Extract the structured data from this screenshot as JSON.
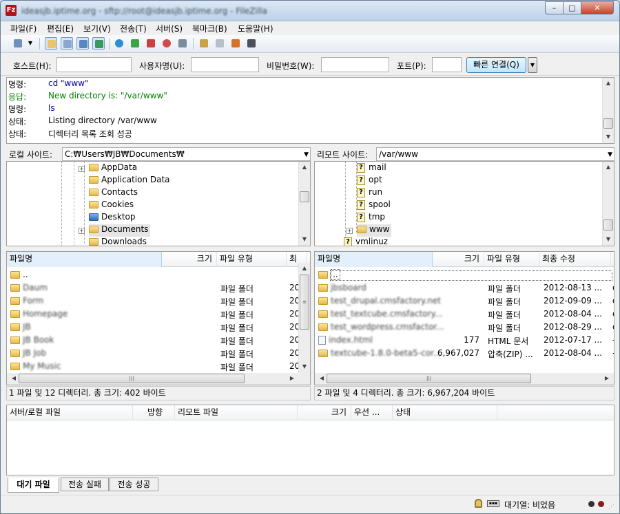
{
  "window": {
    "title": "ideasjb.iptime.org - sftp://root@ideasjb.iptime.org - FileZilla"
  },
  "menu": [
    "파일(F)",
    "편집(E)",
    "보기(V)",
    "전송(T)",
    "서버(S)",
    "북마크(B)",
    "도움말(H)"
  ],
  "quickconnect": {
    "host_label": "호스트(H):",
    "user_label": "사용자명(U):",
    "pass_label": "비밀번호(W):",
    "port_label": "포트(P):",
    "button": "빠른 연결(Q)"
  },
  "log": [
    {
      "kind": "명령:",
      "msg": "cd \"www\"",
      "color": "#0000b0"
    },
    {
      "kind": "응답:",
      "msg": "New directory is: \"/var/www\"",
      "color": "#008000"
    },
    {
      "kind": "명령:",
      "msg": "ls",
      "color": "#0000b0"
    },
    {
      "kind": "상태:",
      "msg": "Listing directory /var/www",
      "color": "#000000"
    },
    {
      "kind": "상태:",
      "msg": "디렉터리 목록 조회 성공",
      "color": "#000000"
    }
  ],
  "local": {
    "label": "로컬 사이트:",
    "path": "C:₩Users₩JB₩Documents₩",
    "tree": [
      "AppData",
      "Application Data",
      "Contacts",
      "Cookies",
      "Desktop",
      "Documents",
      "Downloads"
    ],
    "columns": [
      "파일명",
      "크기",
      "파일 유형",
      "최"
    ],
    "files": [
      {
        "name": "..",
        "type": "",
        "date": ""
      },
      {
        "name": "Daum",
        "type": "파일 폴더",
        "date": "20"
      },
      {
        "name": "Form",
        "type": "파일 폴더",
        "date": "20"
      },
      {
        "name": "Homepage",
        "type": "파일 폴더",
        "date": "20"
      },
      {
        "name": "JB",
        "type": "파일 폴더",
        "date": "20"
      },
      {
        "name": "JB Book",
        "type": "파일 폴더",
        "date": "20"
      },
      {
        "name": "JB Job",
        "type": "파일 폴더",
        "date": "20"
      },
      {
        "name": "My Music",
        "type": "파일 폴더",
        "date": "20"
      }
    ],
    "status": "1 파일 및 12 디렉터리. 총 크기: 402 바이트"
  },
  "remote": {
    "label": "리모트 사이트:",
    "path": "/var/www",
    "tree": [
      "mail",
      "opt",
      "run",
      "spool",
      "tmp",
      "www",
      "vmlinuz"
    ],
    "columns": [
      "파일명",
      "크기",
      "파일 유형",
      "최종 수정",
      "ㄱ"
    ],
    "files": [
      {
        "name": "..",
        "size": "",
        "type": "",
        "date": "",
        "extra": ""
      },
      {
        "name": "jbsboard",
        "size": "",
        "type": "파일 폴더",
        "date": "2012-08-13 ...",
        "extra": "d"
      },
      {
        "name": "test_drupal.cmsfactory.net",
        "size": "",
        "type": "파일 폴더",
        "date": "2012-09-09 ...",
        "extra": "d"
      },
      {
        "name": "test_textcube.cmsfactory...",
        "size": "",
        "type": "파일 폴더",
        "date": "2012-08-04 ...",
        "extra": "d"
      },
      {
        "name": "test_wordpress.cmsfactor...",
        "size": "",
        "type": "파일 폴더",
        "date": "2012-08-29 ...",
        "extra": "d"
      },
      {
        "name": "index.html",
        "size": "177",
        "type": "HTML 문서",
        "date": "2012-07-17 ...",
        "extra": "-"
      },
      {
        "name": "textcube-1.8.0-beta5-cor...",
        "size": "6,967,027",
        "type": "압축(ZIP) ...",
        "date": "2012-08-04 ...",
        "extra": "-"
      }
    ],
    "status": "2 파일 및 4 디렉터리. 총 크기: 6,967,204 바이트"
  },
  "queue": {
    "columns": [
      "서버/로컬 파일",
      "방향",
      "리모트 파일",
      "크기",
      "우선 ...",
      "상태"
    ],
    "tabs": [
      "대기 파일",
      "전송 실패",
      "전송 성공"
    ]
  },
  "statusbar": {
    "queue": "대기열: 비었음"
  }
}
